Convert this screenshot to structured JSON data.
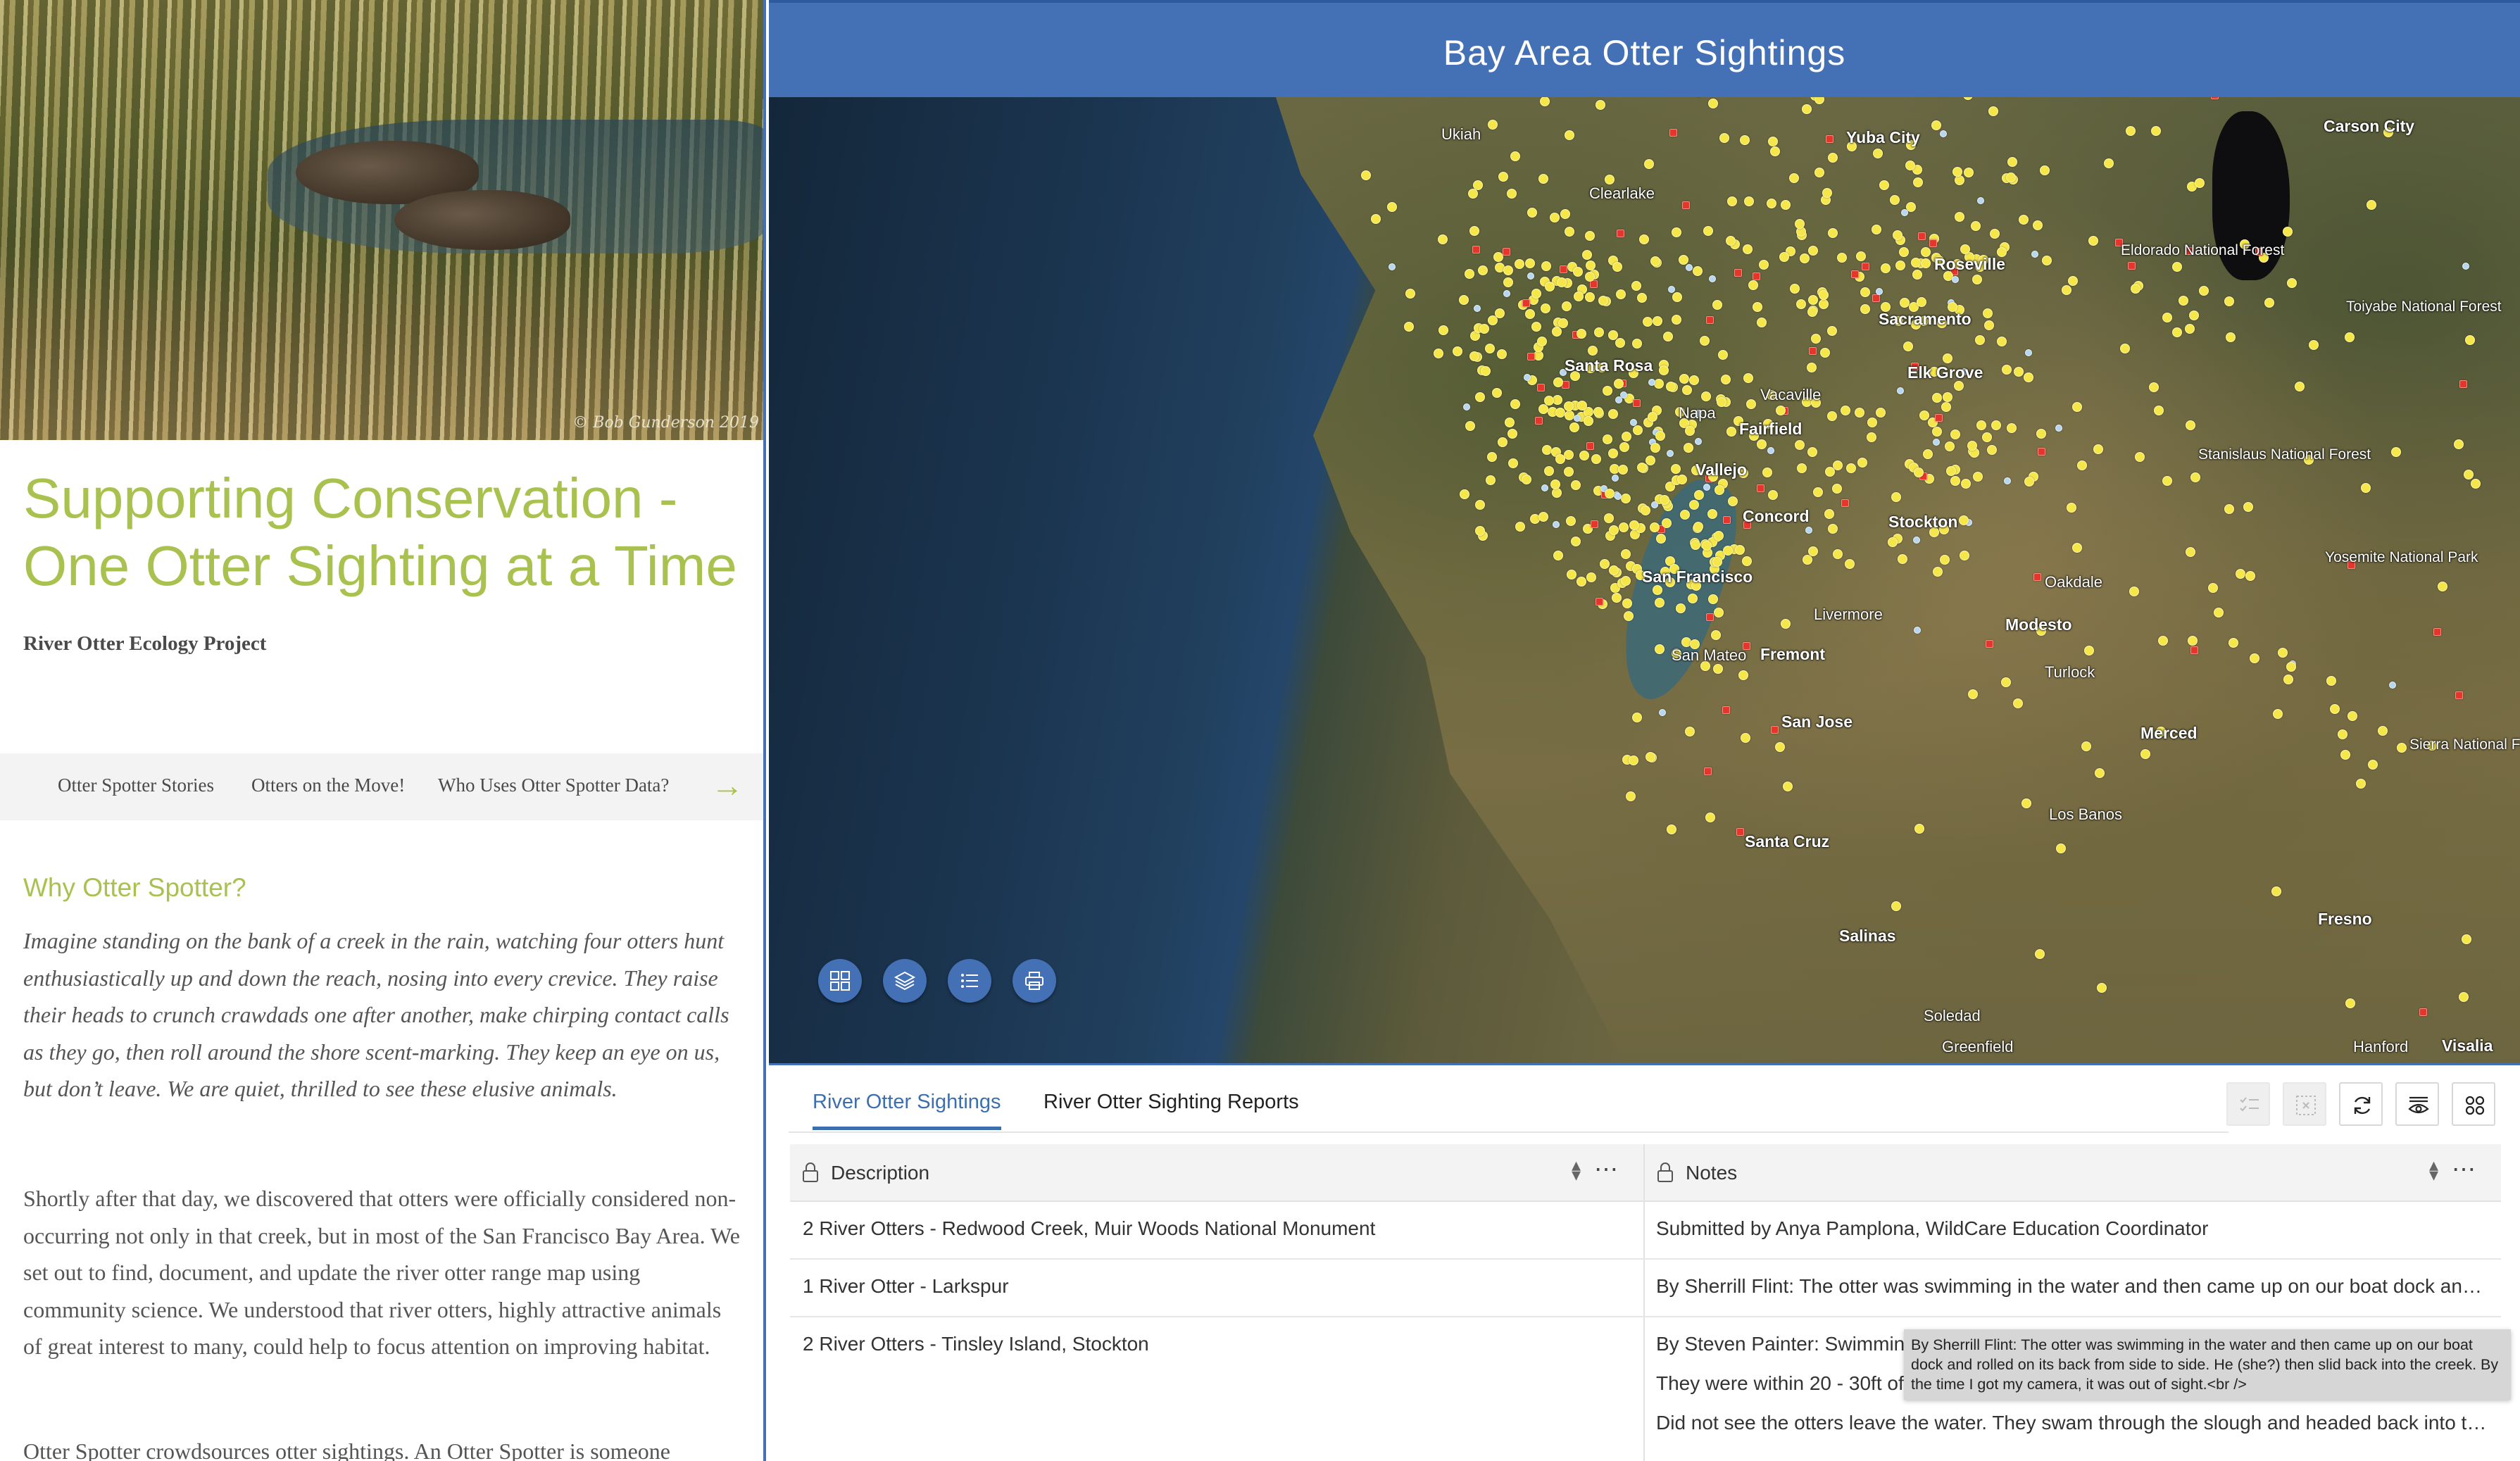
{
  "story": {
    "photo_credit": "© Bob Gunderson 2019",
    "title": "Supporting Conservation - One Otter Sighting at a Time",
    "byline": "River Otter Ecology Project",
    "nav": [
      "Otter Spotter Stories",
      "Otters on the Move!",
      "Who Uses Otter Spotter Data?"
    ],
    "nav_arrow": "→",
    "heading": "Why Otter Spotter?",
    "para1": "Imagine standing on the bank of a creek in the rain, watching four otters hunt enthusiastically up and down the reach, nosing into every crevice. They raise their heads to crunch crawdads one after another, make chirping contact calls as they go, then roll around the shore scent-marking. They keep an eye on us, but don’t leave. We are quiet, thrilled to see these elusive animals.",
    "para2": "Shortly after that day, we discovered that otters were officially considered non-occurring not only in that creek, but in most of the San Francisco Bay Area. We set out to find, document, and update the river otter range map using community science. We understood that river otters, highly attractive animals of great interest to many, could help to focus attention on improving habitat.",
    "para3": "Otter Spotter crowdsources otter sightings. An Otter Spotter is someone"
  },
  "app": {
    "title": "Bay Area Otter Sightings",
    "map_tools": [
      "grid-icon",
      "layers-icon",
      "list-icon",
      "print-icon"
    ],
    "cities": {
      "ukiah": "Ukiah",
      "yuba_city": "Yuba City",
      "carson_city": "Carson City",
      "clearlake": "Clearlake",
      "roseville": "Roseville",
      "eldorado": "Eldorado National Forest",
      "sacramento": "Sacramento",
      "toiyabe": "Toiyabe National Forest",
      "santa_rosa": "Santa Rosa",
      "elk_grove": "Elk Grove",
      "vacaville": "Vacaville",
      "napa": "Napa",
      "fairfield": "Fairfield",
      "stanislaus": "Stanislaus National Forest",
      "vallejo": "Vallejo",
      "concord": "Concord",
      "stockton": "Stockton",
      "yosemite": "Yosemite National Park",
      "san_francisco": "San Francisco",
      "oakdale": "Oakdale",
      "livermore": "Livermore",
      "modesto": "Modesto",
      "san_mateo": "San Mateo",
      "fremont": "Fremont",
      "turlock": "Turlock",
      "san_jose": "San Jose",
      "merced": "Merced",
      "sierra": "Sierra National Forest",
      "los_banos": "Los Banos",
      "santa_cruz": "Santa Cruz",
      "fresno": "Fresno",
      "salinas": "Salinas",
      "soledad": "Soledad",
      "greenfield": "Greenfield",
      "hanford": "Hanford",
      "visalia": "Visalia"
    },
    "tabs": [
      "River Otter Sightings",
      "River Otter Sighting Reports"
    ],
    "table": {
      "columns": [
        "Description",
        "Notes"
      ],
      "rows": [
        {
          "description": "2 River Otters - Redwood Creek, Muir Woods National Monument",
          "notes": [
            "Submitted by Anya Pamplona, WildCare Education Coordinator"
          ]
        },
        {
          "description": "1 River Otter - Larkspur",
          "notes": [
            "By Sherrill Flint: The otter was swimming in the water and then came up on our boat dock and rolled on its back from side to side."
          ]
        },
        {
          "description": "2 River Otters - Tinsley Island, Stockton",
          "notes": [
            "By Steven Painter: Swimming",
            "They were within 20 - 30ft of",
            "Did not see the otters leave the water. They swam through the slough and headed back into the marsh."
          ]
        }
      ]
    },
    "tooltip": "By Sherrill Flint:  The otter was swimming in the water and then came up on our boat dock and rolled on its back from side to side. He (she?) then slid back into the creek. By the time I got my camera, it was out of sight.<br />"
  }
}
